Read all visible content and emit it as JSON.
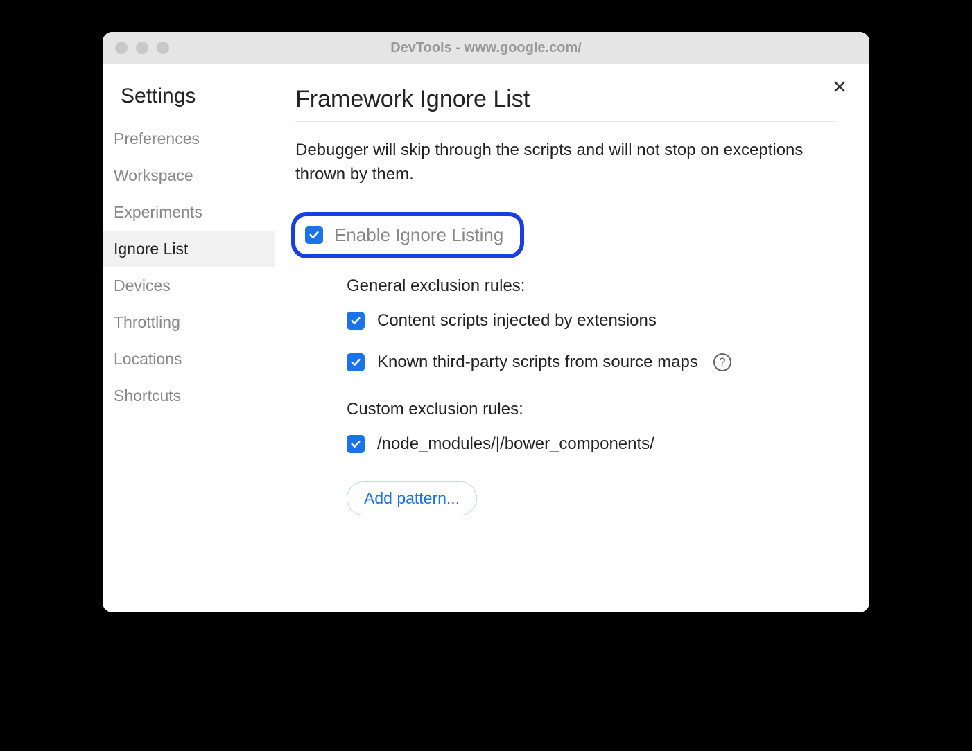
{
  "window": {
    "title": "DevTools - www.google.com/"
  },
  "settings": {
    "heading": "Settings",
    "items": [
      {
        "label": "Preferences",
        "active": false
      },
      {
        "label": "Workspace",
        "active": false
      },
      {
        "label": "Experiments",
        "active": false
      },
      {
        "label": "Ignore List",
        "active": true
      },
      {
        "label": "Devices",
        "active": false
      },
      {
        "label": "Throttling",
        "active": false
      },
      {
        "label": "Locations",
        "active": false
      },
      {
        "label": "Shortcuts",
        "active": false
      }
    ]
  },
  "page": {
    "title": "Framework Ignore List",
    "description": "Debugger will skip through the scripts and will not stop on exceptions thrown by them.",
    "enable_label": "Enable Ignore Listing",
    "general_heading": "General exclusion rules:",
    "general_rules": [
      {
        "label": "Content scripts injected by extensions",
        "help": false
      },
      {
        "label": "Known third-party scripts from source maps",
        "help": true
      }
    ],
    "custom_heading": "Custom exclusion rules:",
    "custom_rules": [
      {
        "label": "/node_modules/|/bower_components/"
      }
    ],
    "add_pattern_label": "Add pattern..."
  }
}
